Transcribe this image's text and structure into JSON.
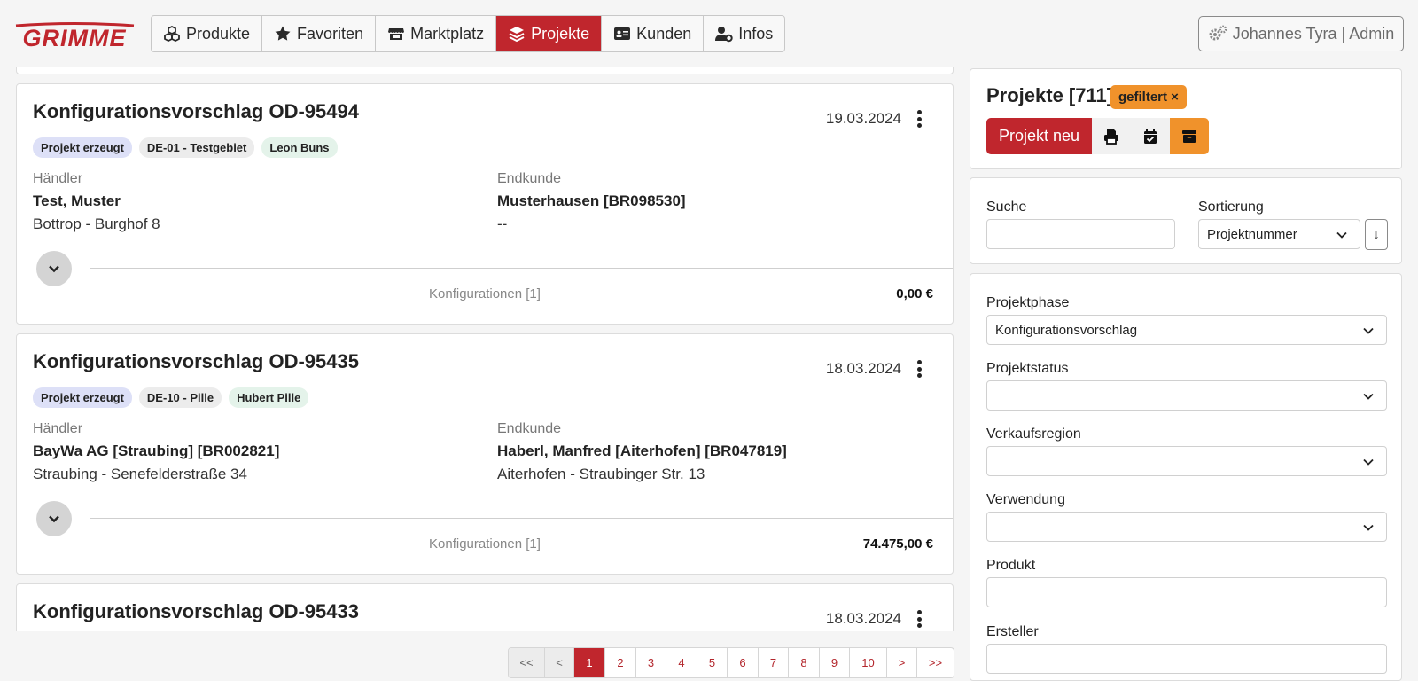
{
  "brand": {
    "logo_text": "GRIMME",
    "accent": "#c0262d",
    "filter_color": "#f0922b"
  },
  "nav": {
    "items": [
      {
        "label": "Produkte",
        "icon": "cubes-icon",
        "active": false
      },
      {
        "label": "Favoriten",
        "icon": "star-icon",
        "active": false
      },
      {
        "label": "Marktplatz",
        "icon": "store-icon",
        "active": false
      },
      {
        "label": "Projekte",
        "icon": "layers-icon",
        "active": true
      },
      {
        "label": "Kunden",
        "icon": "id-card-icon",
        "active": false
      },
      {
        "label": "Infos",
        "icon": "user-gear-icon",
        "active": false
      }
    ]
  },
  "user": {
    "label": "Johannes Tyra | Admin",
    "icon": "gears-icon"
  },
  "projects": [
    {
      "title": "Konfigurationsvorschlag OD-95494",
      "date": "19.03.2024",
      "tags": [
        "Projekt erzeugt",
        "DE-01 - Testgebiet",
        "Leon Buns"
      ],
      "dealer_label": "Händler",
      "dealer_name": "Test, Muster",
      "dealer_address": "Bottrop - Burghof 8",
      "customer_label": "Endkunde",
      "customer_name": "Musterhausen [BR098530]",
      "customer_address": "--",
      "configurations": "Konfigurationen [1]",
      "price": "0,00 €"
    },
    {
      "title": "Konfigurationsvorschlag OD-95435",
      "date": "18.03.2024",
      "tags": [
        "Projekt erzeugt",
        "DE-10 - Pille",
        "Hubert Pille"
      ],
      "dealer_label": "Händler",
      "dealer_name": "BayWa AG [Straubing] [BR002821]",
      "dealer_address": "Straubing - Senefelderstraße 34",
      "customer_label": "Endkunde",
      "customer_name": "Haberl, Manfred [Aiterhofen] [BR047819]",
      "customer_address": "Aiterhofen - Straubinger Str. 13",
      "configurations": "Konfigurationen [1]",
      "price": "74.475,00 €"
    },
    {
      "title": "Konfigurationsvorschlag OD-95433",
      "date": "18.03.2024"
    }
  ],
  "pagination": {
    "items": [
      "<<",
      "<",
      "1",
      "2",
      "3",
      "4",
      "5",
      "6",
      "7",
      "8",
      "9",
      "10",
      ">",
      ">>"
    ],
    "current": "1"
  },
  "sidebar": {
    "title": "Projekte [711]",
    "filter_badge": "gefiltert ×",
    "new_button": "Projekt neu",
    "actions": [
      "print-icon",
      "calendar-check-icon",
      "archive-icon"
    ],
    "search_label": "Suche",
    "search_value": "",
    "sort_label": "Sortierung",
    "sort_value": "Projektnummer",
    "sort_direction": "↓",
    "filters": [
      {
        "label": "Projektphase",
        "value": "Konfigurationsvorschlag",
        "type": "select"
      },
      {
        "label": "Projektstatus",
        "value": "",
        "type": "select"
      },
      {
        "label": "Verkaufsregion",
        "value": "",
        "type": "select"
      },
      {
        "label": "Verwendung",
        "value": "",
        "type": "select"
      },
      {
        "label": "Produkt",
        "value": "",
        "type": "input"
      },
      {
        "label": "Ersteller",
        "value": "",
        "type": "input"
      }
    ]
  }
}
